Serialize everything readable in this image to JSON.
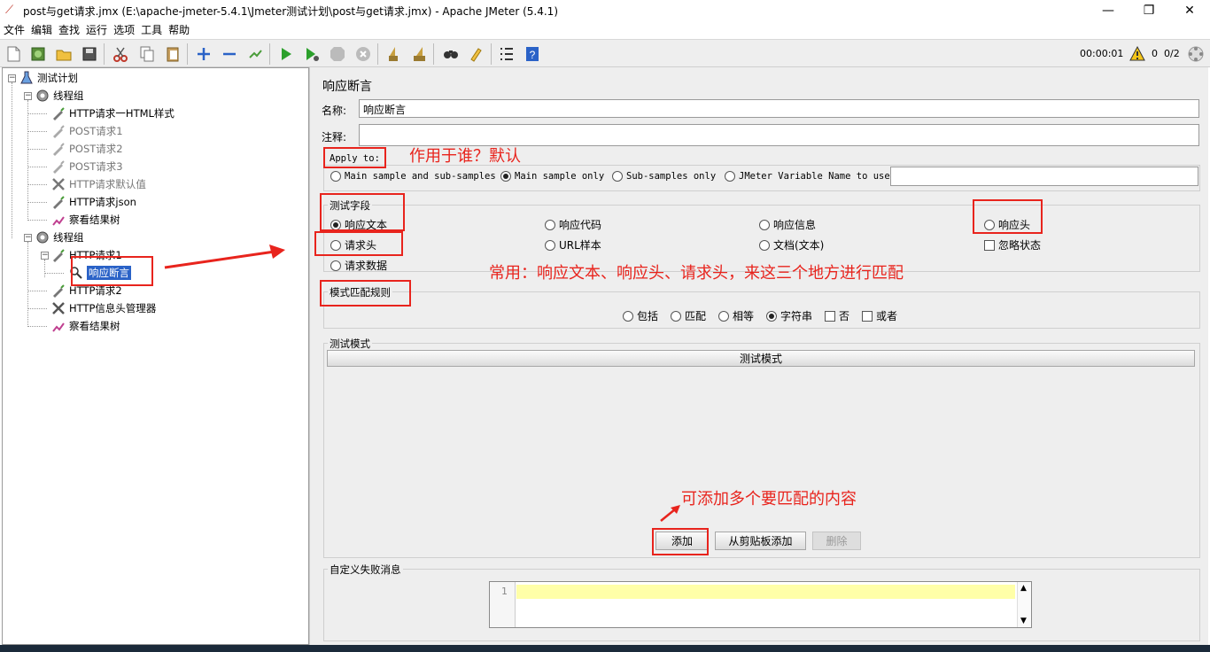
{
  "window": {
    "title": "post与get请求.jmx (E:\\apache-jmeter-5.4.1\\Jmeter测试计划\\post与get请求.jmx) - Apache JMeter (5.4.1)",
    "minimize": "—",
    "maximize": "❐",
    "close": "✕"
  },
  "menu": [
    "文件",
    "编辑",
    "查找",
    "运行",
    "选项",
    "工具",
    "帮助"
  ],
  "toolbar": {
    "timer": "00:00:01",
    "warnings": "0",
    "threads": "0/2"
  },
  "tree": {
    "root": "测试计划",
    "group1": "线程组",
    "g1_items": [
      "HTTP请求一HTML样式",
      "POST请求1",
      "POST请求2",
      "POST请求3",
      "HTTP请求默认值",
      "HTTP请求json",
      "察看结果树"
    ],
    "group2": "线程组",
    "g2_http1": "HTTP请求1",
    "g2_assert": "响应断言",
    "g2_http2": "HTTP请求2",
    "g2_header": "HTTP信息头管理器",
    "g2_result": "察看结果树"
  },
  "panel": {
    "heading": "响应断言",
    "name_label": "名称:",
    "name_value": "响应断言",
    "comment_label": "注释:",
    "comment_value": "",
    "apply_to": "Apply to:",
    "apply_options": [
      "Main sample and sub-samples",
      "Main sample only",
      "Sub-samples only",
      "JMeter Variable Name to use"
    ],
    "apply_selected": 1,
    "variable_value": "",
    "field_title": "测试字段",
    "fields": [
      "响应文本",
      "响应代码",
      "响应信息",
      "响应头",
      "请求头",
      "URL样本",
      "文档(文本)",
      "忽略状态",
      "请求数据"
    ],
    "rule_title": "模式匹配规则",
    "rules": [
      "包括",
      "匹配",
      "相等",
      "字符串",
      "否",
      "或者"
    ],
    "pattern_title": "测试模式",
    "pattern_header": "测试模式",
    "buttons": {
      "add": "添加",
      "add_clipboard": "从剪贴板添加",
      "delete": "删除"
    },
    "failure_title": "自定义失败消息",
    "line_number": "1"
  },
  "annotations": {
    "apply_note": "作用于谁？默认",
    "common_note": "常用：响应文本、响应头、请求头，来这三个地方进行匹配",
    "add_note": "可添加多个要匹配的内容"
  },
  "colors": {
    "annotation": "#e8241d",
    "selection": "#2a62c7",
    "highlight_line": "#ffffa8"
  }
}
